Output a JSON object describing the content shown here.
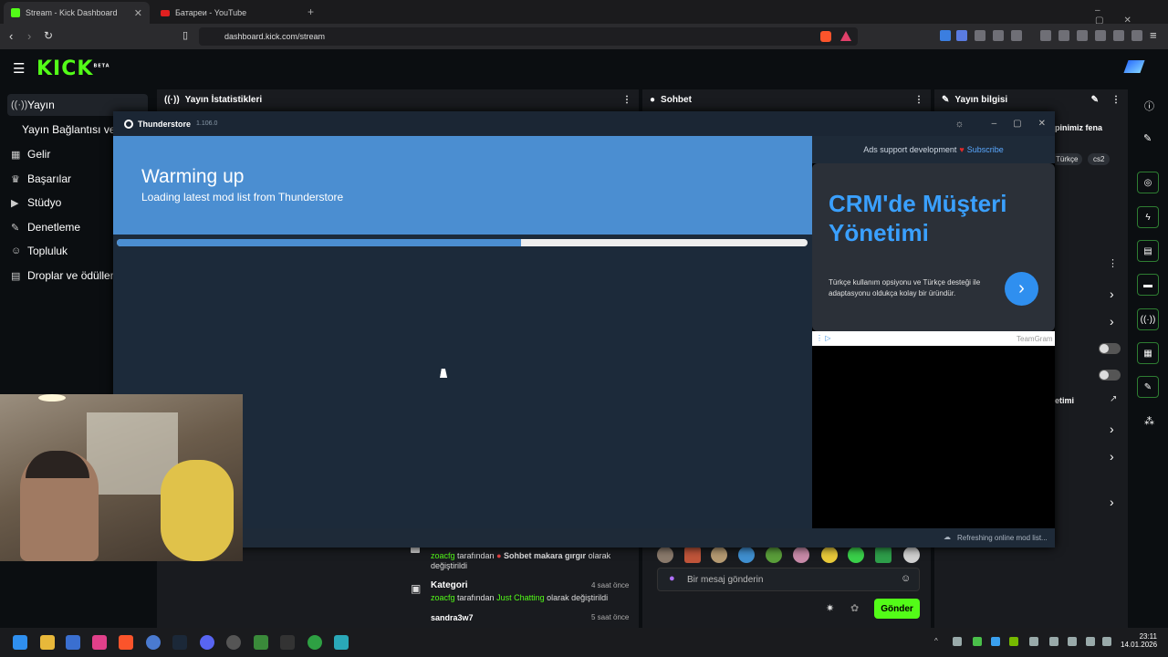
{
  "browser": {
    "tabs": [
      {
        "title": "Stream - Kick Dashboard",
        "active": true
      },
      {
        "title": "Батареи - YouTube",
        "active": false
      }
    ],
    "new_tab": "+",
    "url": "dashboard.kick.com/stream"
  },
  "kick": {
    "logo": "KICK",
    "beta": "BETA",
    "sidebar": [
      {
        "icon": "broadcast-icon",
        "label": "Yayın"
      },
      {
        "icon": "",
        "label": "Yayın Bağlantısı ve ..."
      },
      {
        "icon": "dashboard-icon",
        "label": "Gelir"
      },
      {
        "icon": "trophy-icon",
        "label": "Başarılar"
      },
      {
        "icon": "video-icon",
        "label": "Stüdyo"
      },
      {
        "icon": "wrench-icon",
        "label": "Denetleme"
      },
      {
        "icon": "community-icon",
        "label": "Topluluk"
      },
      {
        "icon": "gift-icon",
        "label": "Droplar ve ödüller"
      }
    ],
    "panels": {
      "stats": "Yayın İstatistikleri",
      "chat": "Sohbet",
      "info": "Yayın bilgisi",
      "info_snippet": "pinimiz fena",
      "tags": [
        "Türkçe",
        "cs2"
      ],
      "info_item": "etimi"
    },
    "activity": [
      {
        "user": "zoacfg",
        "text": " tarafından ",
        "highlight": "Sohbet makara gırgır",
        "suffix": " olarak değiştirildi",
        "time": ""
      },
      {
        "title": "Kategori",
        "time": "4 saat önce",
        "user": "zoacfg",
        "text": " tarafından ",
        "highlight": "Just Chatting",
        "suffix": " olarak değiştirildi"
      },
      {
        "user": "sandra3w7",
        "time": "5 saat önce"
      }
    ],
    "chat_input_placeholder": "Bir mesaj gönderin",
    "send_label": "Gönder"
  },
  "thunderstore": {
    "title": "Thunderstore",
    "version": "1.106.0",
    "heading": "Warming up",
    "subheading": "Loading latest mod list from Thunderstore",
    "progress": 0.585,
    "ad_support_text": "Ads support development",
    "subscribe_label": "Subscribe",
    "ad": {
      "headline": "CRM'de Müşteri Yönetimi",
      "body": "Türkçe kullanım opsiyonu ve Türkçe desteği ile adaptasyonu oldukça kolay bir üründür.",
      "advertiser": "TeamGram"
    },
    "status": "Refreshing online mod list..."
  },
  "taskbar": {
    "time": "23:11",
    "date": "14.01.2026"
  },
  "colors": {
    "kick_green": "#53fc18",
    "ts_blue": "#4b8ed1",
    "ts_dark": "#1c2a3a"
  }
}
